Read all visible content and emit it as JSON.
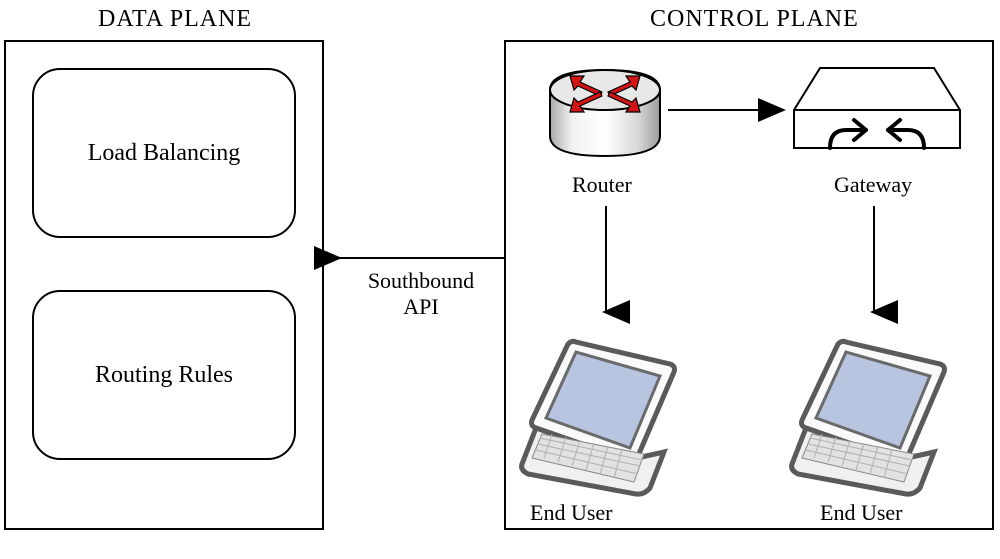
{
  "data_plane": {
    "title": "DATA PLANE",
    "boxes": [
      "Load Balancing",
      "Routing Rules"
    ]
  },
  "control_plane": {
    "title": "CONTROL PLANE",
    "router_label": "Router",
    "gateway_label": "Gateway",
    "end_user_label_left": "End User",
    "end_user_label_right": "End User"
  },
  "api_label_line1": "Southbound",
  "api_label_line2": "API"
}
